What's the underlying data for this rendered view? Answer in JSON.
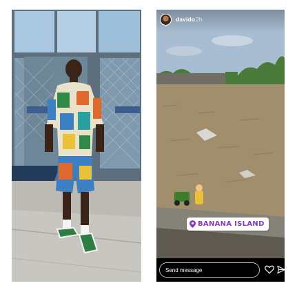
{
  "left_photo": {
    "description_icon": "person-photo"
  },
  "story": {
    "username": "davido",
    "timestamp": "2h",
    "location_sticker": "BANANA ISLAND",
    "reply_placeholder": "Send message",
    "icons": {
      "avatar": "profile-avatar",
      "heart": "heart-icon",
      "share": "paper-plane-icon",
      "location": "location-pin-icon"
    },
    "colors": {
      "location_text": "#8a3ab9",
      "footer_bg": "#000000"
    }
  }
}
